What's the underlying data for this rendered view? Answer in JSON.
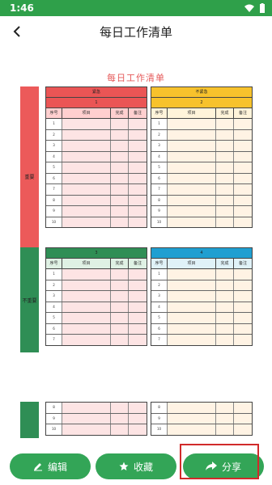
{
  "status": {
    "time": "1:46"
  },
  "header": {
    "title": "每日工作清单"
  },
  "document": {
    "title": "每日工作清单",
    "side_labels": {
      "important": "重要",
      "not_important": "不重要"
    },
    "columns": {
      "no": "序号",
      "item": "项目",
      "done": "完成",
      "note": "备注"
    },
    "quadrants": [
      {
        "h1": "紧急",
        "h2": "1",
        "rows": [
          "1",
          "2",
          "3",
          "4",
          "5",
          "6",
          "7",
          "8",
          "9",
          "10"
        ]
      },
      {
        "h1": "不紧急",
        "h2": "2",
        "rows": [
          "1",
          "2",
          "3",
          "4",
          "5",
          "6",
          "7",
          "8",
          "9",
          "10"
        ]
      },
      {
        "h1": "3",
        "rows": [
          "1",
          "2",
          "3",
          "4",
          "5",
          "6",
          "7"
        ]
      },
      {
        "h1": "4",
        "rows": [
          "1",
          "2",
          "3",
          "4",
          "5",
          "6",
          "7"
        ]
      },
      {
        "rows": [
          "8",
          "9",
          "10"
        ]
      },
      {
        "rows": [
          "8",
          "9",
          "10"
        ]
      }
    ]
  },
  "toolbar": {
    "edit_label": "编辑",
    "favorite_label": "收藏",
    "share_label": "分享"
  }
}
